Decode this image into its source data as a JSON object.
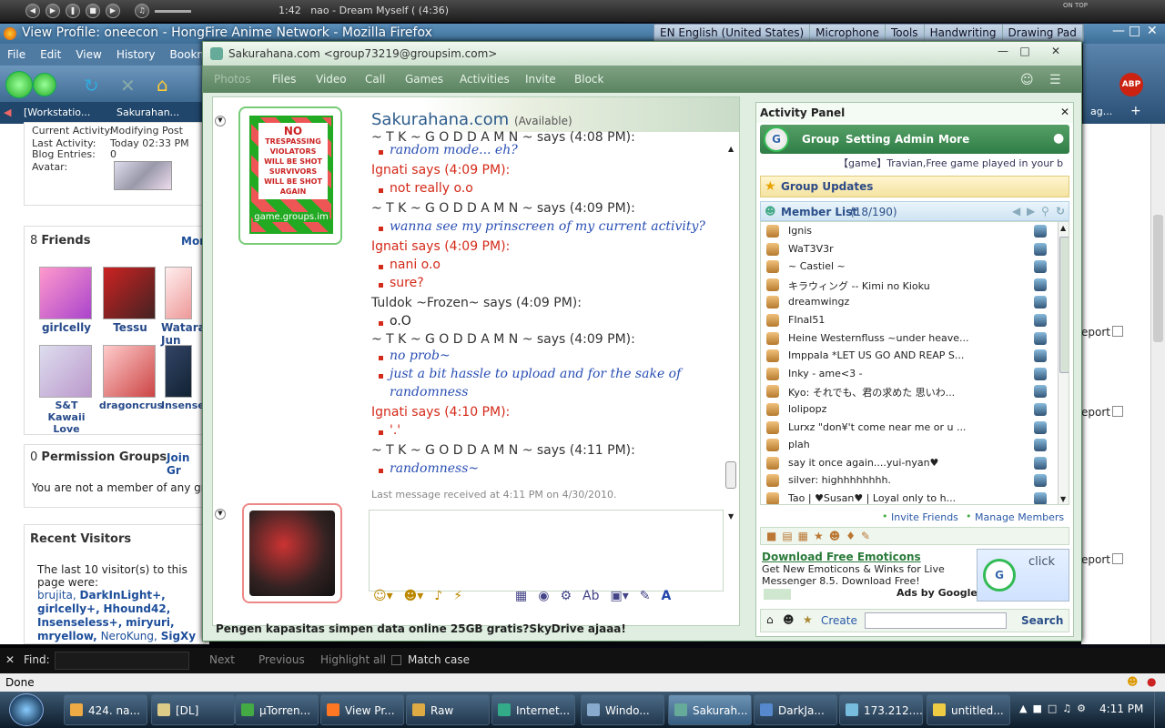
{
  "media_bar": {
    "time": "1:42",
    "track": "nao - Dream Myself ( (4:36)",
    "on_top": "ON TOP"
  },
  "firefox": {
    "title": "View Profile: oneecon - HongFire Anime Network - Mozilla Firefox",
    "menu": [
      "File",
      "Edit",
      "View",
      "History",
      "Bookma"
    ],
    "tabs": [
      "[Workstatio...",
      "Sakurahan..."
    ],
    "right_tab": "ag...",
    "lang": {
      "language": "EN English (United States)",
      "microphone": "Microphone",
      "tools": "Tools",
      "handwriting": "Handwriting",
      "drawing_pad": "Drawing Pad"
    }
  },
  "profile": {
    "current_activity_label": "Current Activity:",
    "current_activity": "Modifying Post",
    "last_activity_label": "Last Activity:",
    "last_activity": "Today 02:33 PM",
    "blog_label": "Blog Entries:",
    "blog_entries": "0",
    "avatar_label": "Avatar:",
    "friends_count": "8",
    "friends_title": "Friends",
    "friends_more": "Mor",
    "friends": [
      "girlcelly",
      "Tessu",
      "Watara Jun",
      "S&T Kawaii Love",
      "dragoncrus",
      "Insensel"
    ],
    "perm_count": "0",
    "perm_title": "Permission Groups",
    "perm_join": "Join Gr",
    "perm_text": "You are not a member of any grou",
    "visitors_title": "Recent Visitors",
    "visitors_intro": "The last 10 visitor(s) to this page were:",
    "visitors": [
      "brujita,",
      "DarkInLight+,",
      "girlcelly+,",
      "Hhound42,",
      "Insenseless+,",
      "miryuri,",
      "mryellow,",
      "NeroKung,",
      "SigXy"
    ],
    "report": "eport"
  },
  "im": {
    "title": "Sakurahana.com <group73219@groupsim.com>",
    "toolbar": [
      "Photos",
      "Files",
      "Video",
      "Call",
      "Games",
      "Activities",
      "Invite",
      "Block"
    ],
    "contact_name": "Sakurahana.com",
    "contact_status": "(Available)",
    "avatar_caption": "game.groups.im",
    "sign_lines": [
      "NO",
      "TRESPASSING",
      "VIOLATORS",
      "WILL BE SHOT",
      "SURVIVORS",
      "WILL BE SHOT",
      "AGAIN"
    ],
    "messages": [
      {
        "type": "name",
        "text": "~ T K ~ G O D D A M N ~ says (4:08 PM):",
        "color": "blk"
      },
      {
        "type": "item",
        "text": "random mode... eh?",
        "color": "blue"
      },
      {
        "type": "name",
        "text": "Ignati says (4:09 PM):",
        "color": "red"
      },
      {
        "type": "item",
        "text": "not really o.o",
        "color": "red"
      },
      {
        "type": "name",
        "text": "~ T K ~ G O D D A M N ~ says (4:09 PM):",
        "color": "blk"
      },
      {
        "type": "item",
        "text": "wanna see my prinscreen of my current activity?",
        "color": "blue"
      },
      {
        "type": "name",
        "text": "Ignati says (4:09 PM):",
        "color": "red"
      },
      {
        "type": "item",
        "text": "nani o.o",
        "color": "red"
      },
      {
        "type": "item",
        "text": "sure?",
        "color": "red"
      },
      {
        "type": "name",
        "text": "Tuldok ~Frozen~ says (4:09 PM):",
        "color": "blk"
      },
      {
        "type": "item",
        "text": "o.O",
        "color": "dark"
      },
      {
        "type": "name",
        "text": "~ T K ~ G O D D A M N ~ says (4:09 PM):",
        "color": "blk"
      },
      {
        "type": "item",
        "text": "no prob~",
        "color": "blue"
      },
      {
        "type": "item",
        "text": "just a bit hassle to upload and for the sake of",
        "color": "blue"
      },
      {
        "type": "cont",
        "text": "randomness",
        "color": "blue"
      },
      {
        "type": "name",
        "text": "Ignati says (4:10 PM):",
        "color": "red"
      },
      {
        "type": "item",
        "text": "'.'",
        "color": "red"
      },
      {
        "type": "name",
        "text": "~ T K ~ G O D D A M N ~ says (4:11 PM):",
        "color": "blk"
      },
      {
        "type": "item",
        "text": "randomness~",
        "color": "blue"
      }
    ],
    "last_message": "Last message received at 4:11 PM on 4/30/2010.",
    "bottom_ad": "Pengen kapasitas simpen data online 25GB gratis?SkyDrive ajaaa!"
  },
  "activity_panel": {
    "title": "Activity Panel",
    "menu": [
      "Group",
      "Setting",
      "Admin",
      "More"
    ],
    "ticker": "【game】Travian,Free game played in your b",
    "group_updates": "Group Updates",
    "member_list": "Member List",
    "member_count": "(18/190)",
    "members": [
      "Ignis",
      "WaT3V3r",
      "~ Castiel ~",
      "キラウィング -- Kimi no Kioku",
      "dreamwingz",
      "FInal51",
      "Heine Westernfluss ~under heave...",
      "Imppala *LET US GO AND REAP S...",
      "Inky - ame<3 -",
      "Kyo: それでも、君の求めた 思いわ...",
      "lolipopz",
      "Lurxz \"don¥'t come near me or u ...",
      "plah",
      "say it once again....yui-nyan♥",
      "silver: highhhhhhhh.",
      "Tao | ♥Susan♥ | Loyal only to h..."
    ],
    "invite": "Invite Friends",
    "manage": "Manage Members",
    "ad_title": "Download Free Emoticons",
    "ad_text": "Get New Emoticons & Winks for Live Messenger 8.5. Download Free!",
    "ads_by": "Ads by Google",
    "ad_click": "click",
    "create": "Create",
    "search": "Search"
  },
  "find_bar": {
    "find": "Find:",
    "next": "Next",
    "previous": "Previous",
    "highlight": "Highlight all",
    "match_case": "Match case"
  },
  "status": "Done",
  "taskbar": {
    "items": [
      "424. na...",
      "[DL]",
      "µTorren...",
      "View Pr...",
      "Raw",
      "Internet...",
      "Windo...",
      "Sakurah...",
      "DarkJa...",
      "173.212....",
      "untitled..."
    ],
    "clock": "4:11 PM"
  },
  "colors": {
    "accent_green": "#3b8f50",
    "name_red": "#d42a19",
    "msg_blue": "#2a4fb4"
  }
}
